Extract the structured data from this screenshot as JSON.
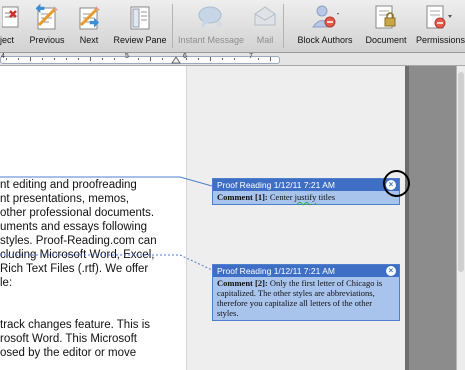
{
  "toolbar": {
    "buttons": [
      {
        "label": "ject",
        "icon": "reject-change-icon"
      },
      {
        "label": "Previous",
        "icon": "previous-change-icon"
      },
      {
        "label": "Next",
        "icon": "next-change-icon"
      },
      {
        "label": "Review Pane",
        "icon": "review-pane-icon"
      },
      {
        "label": "Instant Message",
        "icon": "instant-message-icon"
      },
      {
        "label": "Mail",
        "icon": "mail-icon"
      },
      {
        "label": "Block Authors",
        "icon": "block-authors-icon"
      },
      {
        "label": "Document",
        "icon": "protect-document-icon"
      },
      {
        "label": "Permissions",
        "icon": "permissions-icon"
      }
    ]
  },
  "ruler": {
    "marks": [
      "4",
      "5",
      "6",
      "7"
    ]
  },
  "document": {
    "lines": [
      "nt editing and proofreading",
      "nt presentations, memos,",
      "other professional documents.",
      "uments and essays following",
      "styles. Proof-Reading.com can",
      "cluding Microsoft Word, Excel,",
      "Rich Text Files (.rtf). We offer",
      "le:",
      "",
      "track changes feature. This is",
      "rosoft Word. This Microsoft",
      "osed by the editor or move"
    ]
  },
  "comments": [
    {
      "header": "Proof Reading 1/12/11 7:21 AM",
      "label": "Comment [1]:",
      "text_before": "Center ",
      "text_flagged": "justify",
      "text_after": " titles"
    },
    {
      "header": "Proof Reading 1/12/11 7:21 AM",
      "label": "Comment [2]:",
      "text": "Only the first letter of Chicago is capitalized.  The other styles are abbreviations, therefore you capitalize all letters of the other styles."
    }
  ],
  "colors": {
    "comment_header": "#3f6fc4",
    "comment_body": "#a9c4ec",
    "comment_border": "#4f7fcc",
    "markup_pane": "#eeeeee"
  }
}
